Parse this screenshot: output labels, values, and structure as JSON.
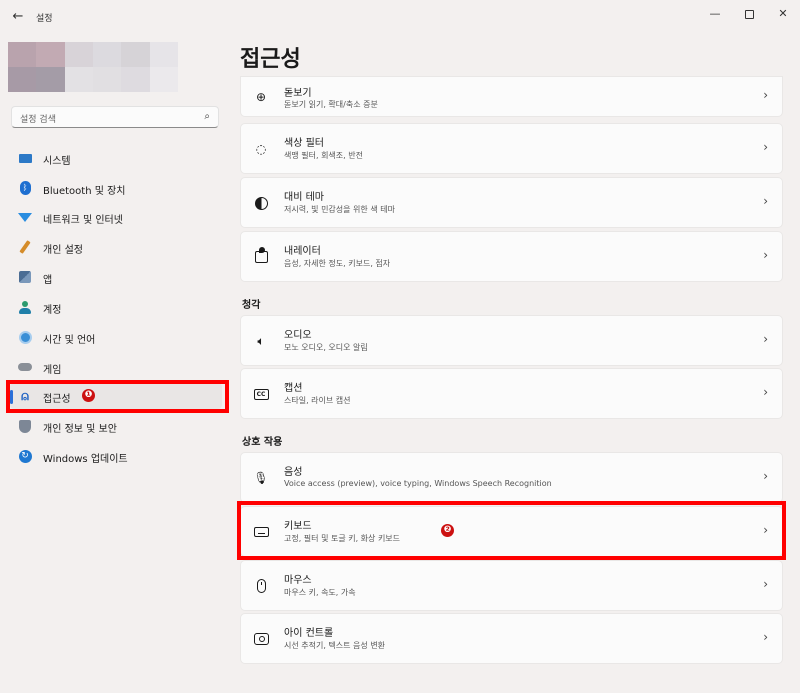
{
  "titlebar": {
    "back_glyph": "←",
    "app_title": "설정",
    "minimize_glyph": "—",
    "close_glyph": "✕"
  },
  "search": {
    "placeholder": "설정 검색",
    "icon_glyph": "⌕"
  },
  "sidebar": {
    "items": [
      {
        "label": "시스템",
        "icon": "system-icon"
      },
      {
        "label": "Bluetooth 및 장치",
        "icon": "bluetooth-icon"
      },
      {
        "label": "네트워크 및 인터넷",
        "icon": "wifi-icon"
      },
      {
        "label": "개인 설정",
        "icon": "brush-icon"
      },
      {
        "label": "앱",
        "icon": "apps-icon"
      },
      {
        "label": "계정",
        "icon": "account-icon"
      },
      {
        "label": "시간 및 언어",
        "icon": "clock-globe-icon"
      },
      {
        "label": "게임",
        "icon": "gamepad-icon"
      },
      {
        "label": "접근성",
        "icon": "accessibility-icon"
      },
      {
        "label": "개인 정보 및 보안",
        "icon": "shield-icon"
      },
      {
        "label": "Windows 업데이트",
        "icon": "update-icon"
      }
    ],
    "active_index": 8,
    "bluetooth_glyph": "ᛒ",
    "access_glyph": "⍝",
    "update_glyph": "↻"
  },
  "annotations": {
    "badge1": "❶",
    "badge2": "❷"
  },
  "main": {
    "page_title": "접근성",
    "vision_cards": [
      {
        "title": "돋보기",
        "sub": "돋보기 읽기, 확대/축소 증분",
        "icon": "magnifier-icon",
        "glyph": "⊕"
      },
      {
        "title": "색상 필터",
        "sub": "색맹 필터, 회색조, 반전",
        "icon": "palette-icon",
        "glyph": "◌"
      },
      {
        "title": "대비 테마",
        "sub": "저시력, 빛 민감성을 위한 색 테마",
        "icon": "contrast-icon"
      },
      {
        "title": "내레이터",
        "sub": "음성, 자세한 정도, 키보드, 점자",
        "icon": "narrator-icon"
      }
    ],
    "hearing_header": "청각",
    "hearing_cards": [
      {
        "title": "오디오",
        "sub": "모노 오디오, 오디오 알림",
        "icon": "speaker-icon",
        "glyph": "🔈︎"
      },
      {
        "title": "캡션",
        "sub": "스타일, 라이브 캡션",
        "icon": "captions-icon",
        "glyph": "CC"
      }
    ],
    "interaction_header": "상호 작용",
    "interaction_cards": [
      {
        "title": "음성",
        "sub": "Voice access (preview), voice typing, Windows Speech Recognition",
        "icon": "microphone-icon",
        "glyph": "🎙︎"
      },
      {
        "title": "키보드",
        "sub": "고정, 필터 및 토글 키, 화상 키보드",
        "icon": "keyboard-icon"
      },
      {
        "title": "마우스",
        "sub": "마우스 키, 속도, 가속",
        "icon": "mouse-icon"
      },
      {
        "title": "아이 컨트롤",
        "sub": "시선 추적기, 텍스트 음성 변환",
        "icon": "eye-control-icon"
      }
    ],
    "chevron_glyph": "›"
  }
}
